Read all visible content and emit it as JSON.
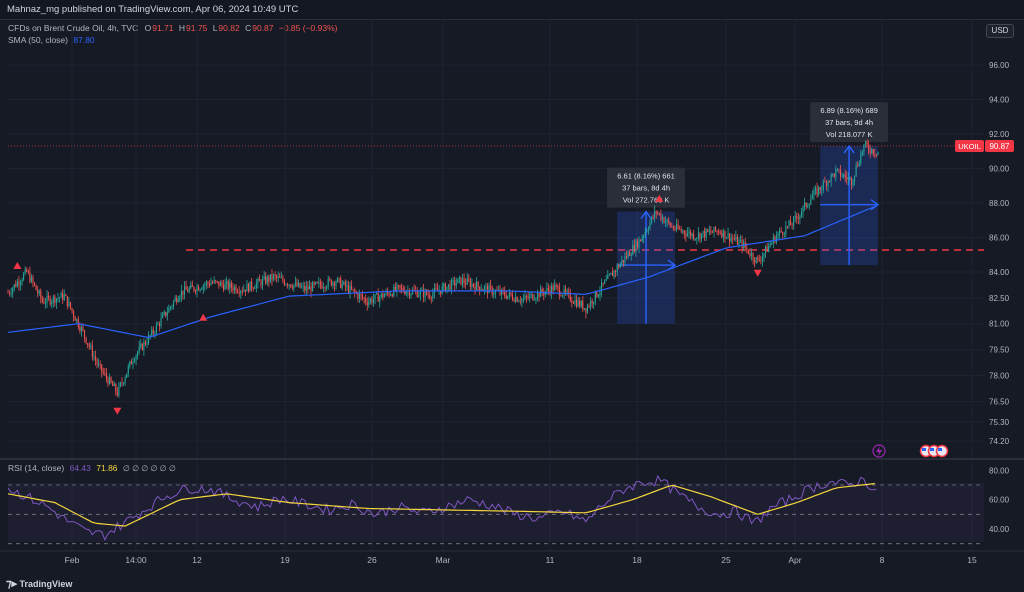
{
  "header": {
    "published_by": "Mahnaz_mg published on TradingView.com, Apr 06, 2024 10:49 UTC"
  },
  "legend": {
    "symbol": "CFDs on Brent Crude Oil, 4h, TVC",
    "o_label": "O",
    "o_value": "91.71",
    "h_label": "H",
    "h_value": "91.75",
    "l_label": "L",
    "l_value": "90.82",
    "c_label": "C",
    "c_value": "90.87",
    "change": "−0.85 (−0.93%)",
    "sma_label": "SMA (50, close)",
    "sma_value": "87.80"
  },
  "currency_button": "USD",
  "price_tag": {
    "symbol": "UKOIL",
    "value": "90.87"
  },
  "rsi_legend": {
    "label": "RSI (14, close)",
    "rsi_value": "64.43",
    "ma_value": "71.86",
    "zeros": "∅ ∅ ∅ ∅ ∅ ∅"
  },
  "measure_boxes": [
    {
      "line1": "6.61 (8.16%) 661",
      "line2": "37 bars, 8d 4h",
      "line3": "Vol 272.763 K"
    },
    {
      "line1": "6.89 (8.16%) 689",
      "line2": "37 bars, 9d 4h",
      "line3": "Vol 218.077 K"
    }
  ],
  "footer": {
    "brand": "TradingView"
  },
  "colors": {
    "up": "#26a69a",
    "down": "#ef5350",
    "sma": "#2962ff",
    "rsi": "#7e57c2",
    "rsi_ma": "#f5d63d",
    "marker": "#f23645",
    "measure": "#2962ff"
  },
  "chart_data": {
    "type": "candlestick",
    "interval": "4h",
    "price_axis_ticks": [
      96.0,
      94.0,
      92.0,
      90.0,
      88.0,
      86.0,
      84.0,
      82.5,
      81.0,
      79.5,
      78.0,
      76.5,
      75.3,
      74.2
    ],
    "time_axis_ticks": [
      "Feb",
      "14:00",
      "12",
      "19",
      "26",
      "Mar",
      "11",
      "18",
      "25",
      "Apr",
      "8",
      "15"
    ],
    "ylim": [
      73.5,
      97.5
    ],
    "resistance_level": 84.5,
    "last_price_line": 90.87,
    "price_path": [
      [
        0,
        82.8
      ],
      [
        12,
        84.0
      ],
      [
        22,
        82.3
      ],
      [
        36,
        82.6
      ],
      [
        48,
        80.5
      ],
      [
        58,
        78.5
      ],
      [
        70,
        77.0
      ],
      [
        80,
        79.0
      ],
      [
        92,
        80.4
      ],
      [
        110,
        82.8
      ],
      [
        130,
        83.4
      ],
      [
        150,
        83.0
      ],
      [
        170,
        83.7
      ],
      [
        190,
        83.0
      ],
      [
        210,
        83.5
      ],
      [
        230,
        82.3
      ],
      [
        250,
        83.0
      ],
      [
        270,
        82.7
      ],
      [
        290,
        83.5
      ],
      [
        310,
        82.9
      ],
      [
        330,
        82.4
      ],
      [
        350,
        83.1
      ],
      [
        370,
        81.9
      ],
      [
        380,
        83.1
      ],
      [
        393,
        84.6
      ],
      [
        405,
        85.9
      ],
      [
        415,
        87.5
      ],
      [
        425,
        86.6
      ],
      [
        440,
        86.1
      ],
      [
        455,
        86.4
      ],
      [
        470,
        85.6
      ],
      [
        480,
        84.6
      ],
      [
        492,
        86.1
      ],
      [
        503,
        86.9
      ],
      [
        515,
        88.4
      ],
      [
        530,
        89.8
      ],
      [
        540,
        89.3
      ],
      [
        548,
        91.3
      ],
      [
        555,
        91.0
      ]
    ],
    "sma_path": [
      [
        0,
        80.5
      ],
      [
        45,
        81.0
      ],
      [
        90,
        80.2
      ],
      [
        130,
        81.4
      ],
      [
        180,
        82.6
      ],
      [
        250,
        82.9
      ],
      [
        320,
        82.9
      ],
      [
        370,
        82.7
      ],
      [
        410,
        83.7
      ],
      [
        460,
        85.4
      ],
      [
        510,
        86.1
      ],
      [
        555,
        87.8
      ]
    ],
    "rsi_ylim": [
      30,
      80
    ],
    "rsi_levels": [
      70,
      50,
      30
    ],
    "rsi_ticks": [
      80.0,
      60.0,
      40.0
    ],
    "rsi_path": [
      [
        0,
        68
      ],
      [
        12,
        62
      ],
      [
        24,
        56
      ],
      [
        36,
        47
      ],
      [
        50,
        38
      ],
      [
        62,
        36
      ],
      [
        74,
        44
      ],
      [
        86,
        52
      ],
      [
        100,
        62
      ],
      [
        115,
        68
      ],
      [
        130,
        67
      ],
      [
        145,
        60
      ],
      [
        160,
        55
      ],
      [
        175,
        61
      ],
      [
        190,
        57
      ],
      [
        205,
        53
      ],
      [
        220,
        57
      ],
      [
        235,
        50
      ],
      [
        250,
        55
      ],
      [
        265,
        51
      ],
      [
        280,
        55
      ],
      [
        295,
        60
      ],
      [
        310,
        56
      ],
      [
        325,
        50
      ],
      [
        340,
        47
      ],
      [
        355,
        52
      ],
      [
        370,
        45
      ],
      [
        382,
        58
      ],
      [
        394,
        67
      ],
      [
        406,
        72
      ],
      [
        418,
        73
      ],
      [
        430,
        63
      ],
      [
        442,
        55
      ],
      [
        454,
        50
      ],
      [
        466,
        52
      ],
      [
        478,
        44
      ],
      [
        490,
        55
      ],
      [
        502,
        61
      ],
      [
        514,
        68
      ],
      [
        526,
        72
      ],
      [
        538,
        70
      ],
      [
        548,
        74
      ],
      [
        555,
        66
      ]
    ],
    "rsi_ma_path": [
      [
        0,
        64
      ],
      [
        30,
        58
      ],
      [
        55,
        44
      ],
      [
        75,
        42
      ],
      [
        110,
        60
      ],
      [
        140,
        64
      ],
      [
        180,
        58
      ],
      [
        230,
        54
      ],
      [
        280,
        53
      ],
      [
        330,
        52
      ],
      [
        370,
        51
      ],
      [
        400,
        60
      ],
      [
        425,
        70
      ],
      [
        450,
        62
      ],
      [
        480,
        50
      ],
      [
        505,
        58
      ],
      [
        530,
        68
      ],
      [
        555,
        71
      ]
    ],
    "measurements": [
      {
        "from_bar": 390,
        "to_bar": 427,
        "price_low": 81.0,
        "price_high": 87.5,
        "change": "6.61 (8.16%) 661",
        "bars": "37 bars, 8d 4h",
        "volume": "Vol 272.763 K"
      },
      {
        "from_bar": 520,
        "to_bar": 557,
        "price_low": 84.4,
        "price_high": 91.3,
        "change": "6.89 (8.16%) 689",
        "bars": "37 bars, 9d 4h",
        "volume": "Vol 218.077 K"
      }
    ],
    "pivot_markers": [
      {
        "bar": 6,
        "price": 84.0,
        "side": "top"
      },
      {
        "bar": 70,
        "price": 76.3,
        "side": "bottom"
      },
      {
        "bar": 125,
        "price": 81.0,
        "side": "top"
      },
      {
        "bar": 417,
        "price": 87.9,
        "side": "top"
      },
      {
        "bar": 480,
        "price": 84.3,
        "side": "bottom"
      }
    ]
  }
}
